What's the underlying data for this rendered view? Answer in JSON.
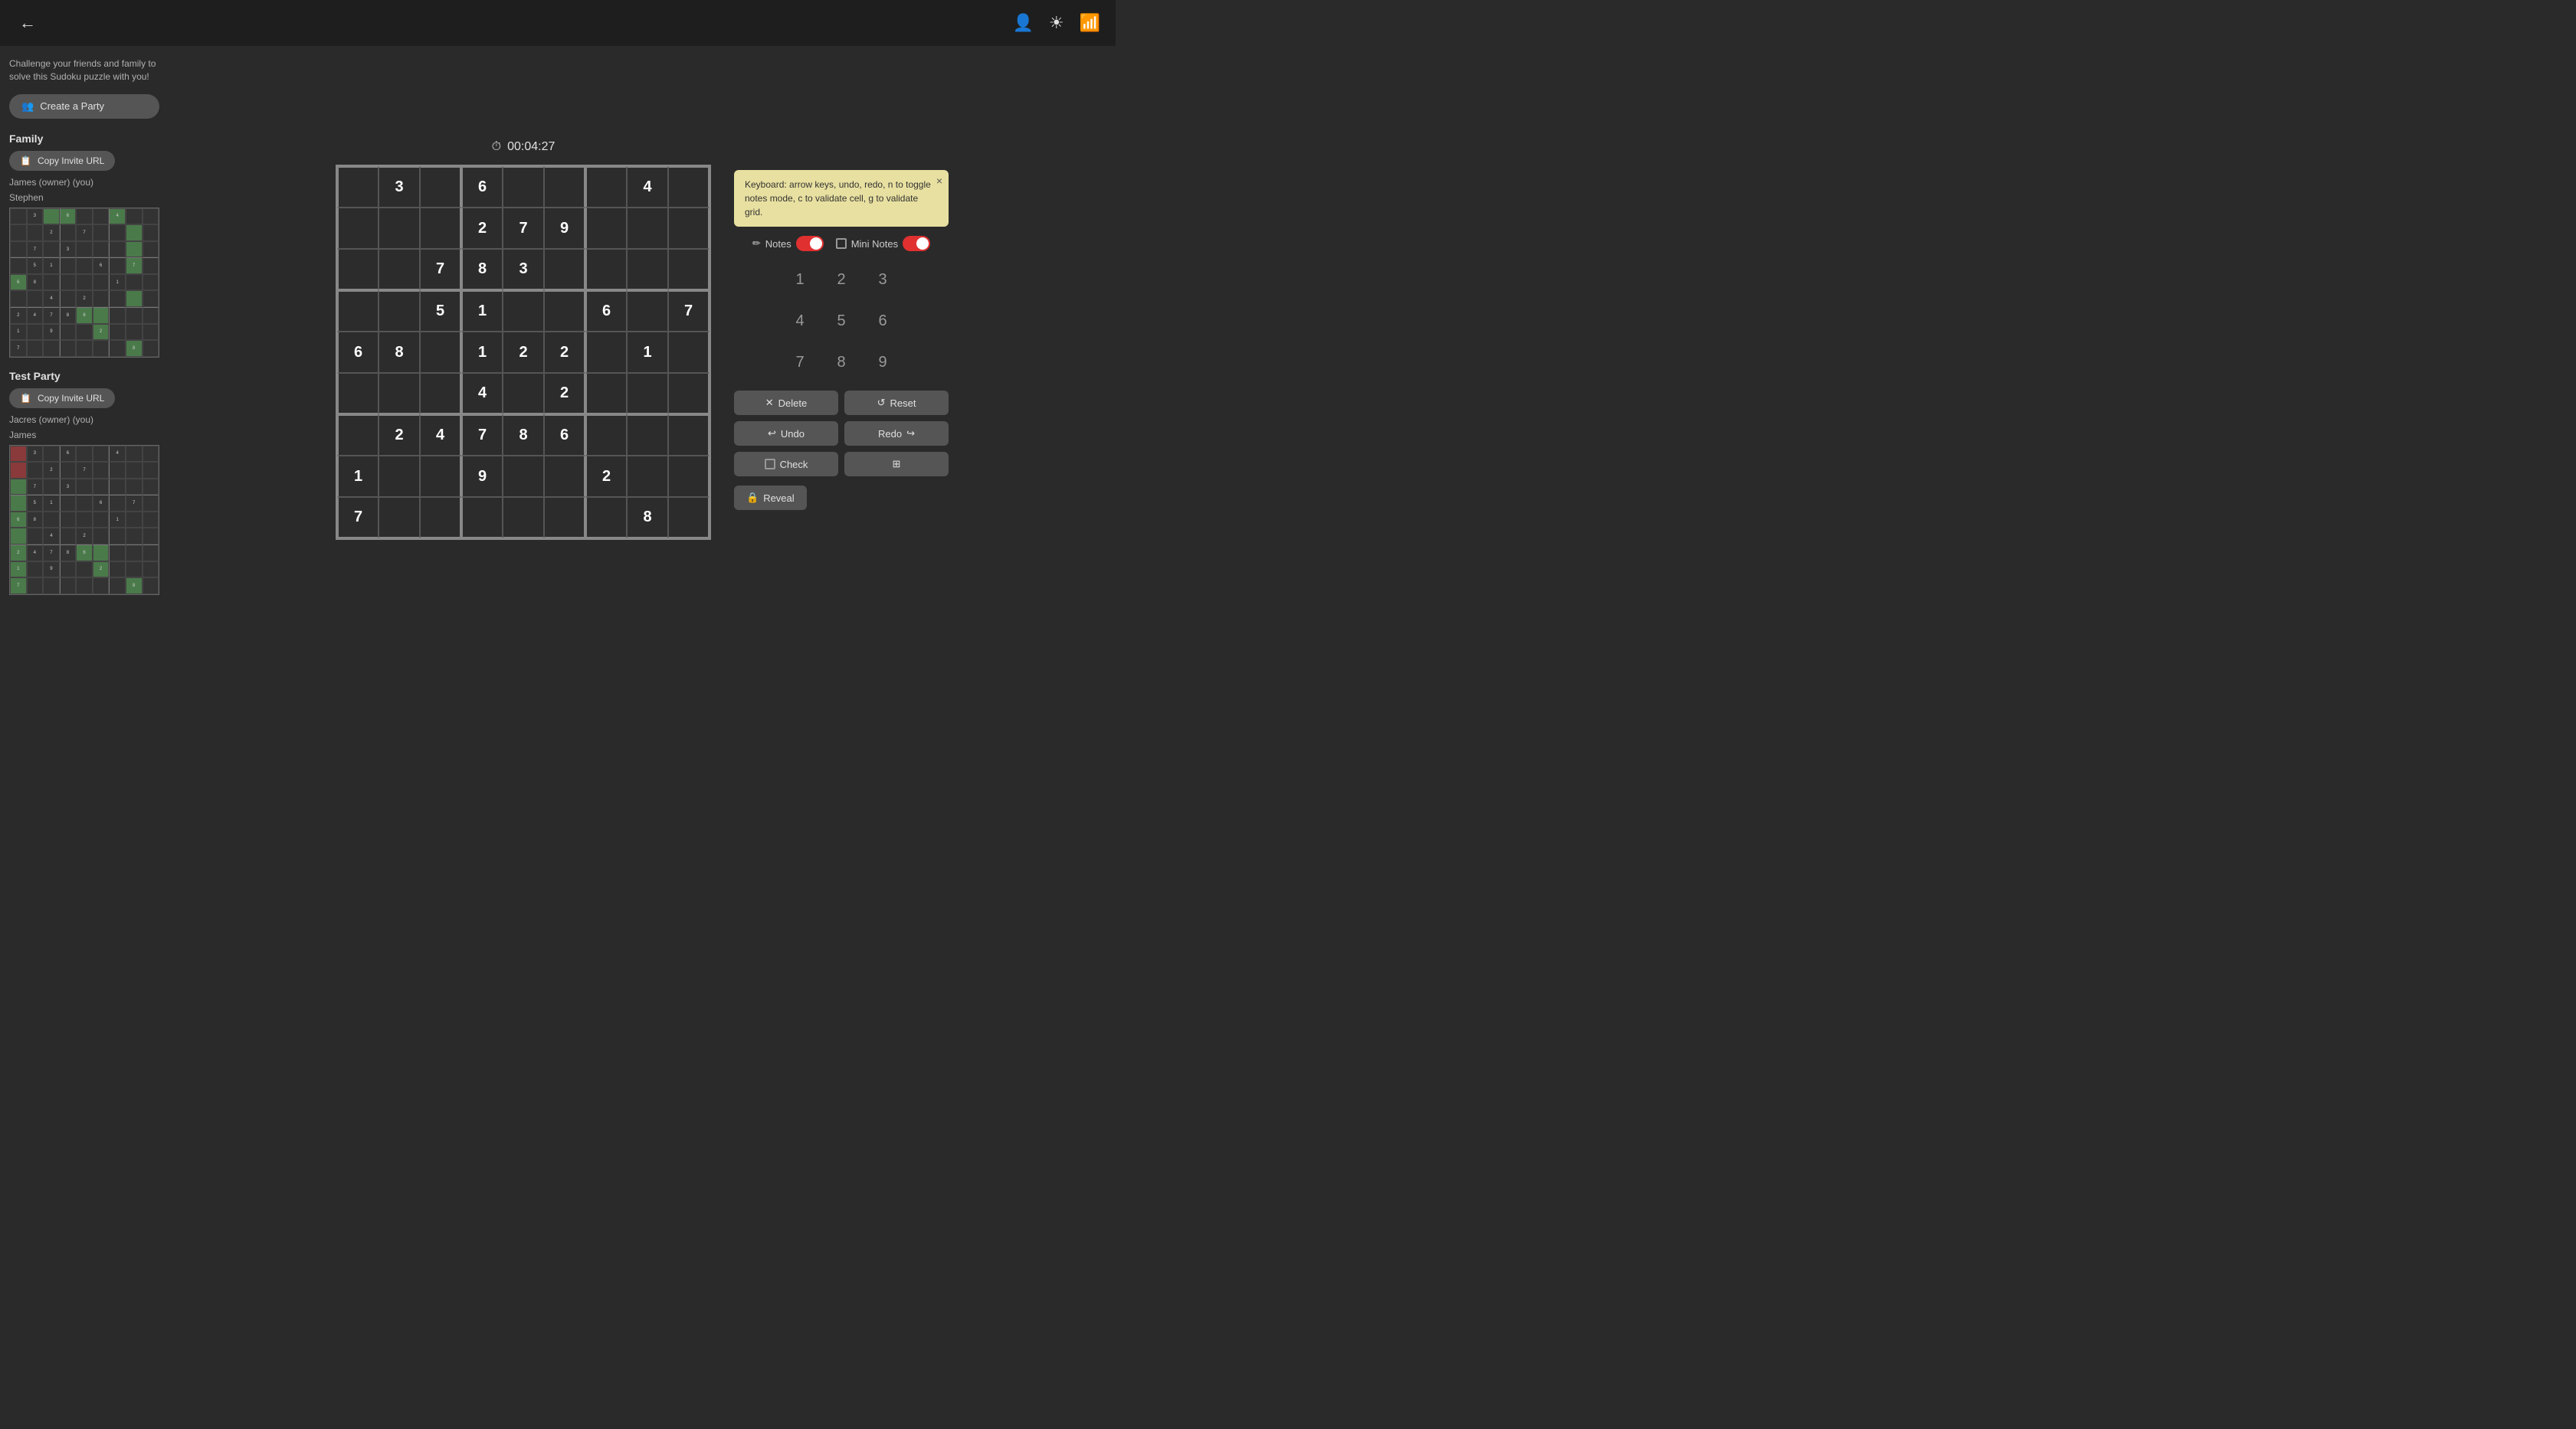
{
  "header": {
    "back_label": "←",
    "icons": [
      "person",
      "brightness",
      "wifi"
    ]
  },
  "sidebar": {
    "description": "Challenge your friends and family to solve this Sudoku puzzle with you!",
    "create_party_label": "Create a Party",
    "parties": [
      {
        "name": "Family",
        "copy_url_label": "Copy Invite URL",
        "members": [
          {
            "name": "James (owner) (you)",
            "grid": null
          },
          {
            "name": "Stephen",
            "grid": [
              [
                "",
                "3",
                "",
                "6",
                "",
                "",
                "4",
                "",
                ""
              ],
              [
                "",
                "",
                "2",
                "",
                "7",
                "",
                "",
                "",
                ""
              ],
              [
                "",
                "7",
                "",
                "3",
                "",
                "",
                "",
                "",
                ""
              ],
              [
                "",
                "5",
                "1",
                "",
                "",
                "6",
                "",
                "7",
                ""
              ],
              [
                "6",
                "8",
                "",
                "",
                "",
                "",
                "1",
                "",
                ""
              ],
              [
                "",
                "",
                "4",
                "",
                "2",
                "",
                "",
                "",
                ""
              ],
              [
                "2",
                "4",
                "7",
                "8",
                "6",
                "",
                "",
                "",
                ""
              ],
              [
                "1",
                "",
                "9",
                "",
                "",
                "2",
                "",
                "",
                ""
              ],
              [
                "7",
                "",
                "",
                "",
                "",
                "",
                "",
                "8",
                ""
              ]
            ],
            "highlights": [
              [
                0,
                2
              ],
              [
                0,
                3
              ],
              [
                0,
                6
              ],
              [
                1,
                7
              ],
              [
                2,
                7
              ],
              [
                3,
                7
              ],
              [
                4,
                0
              ],
              [
                5,
                7
              ],
              [
                6,
                4
              ],
              [
                6,
                5
              ],
              [
                7,
                5
              ],
              [
                8,
                7
              ]
            ]
          }
        ]
      },
      {
        "name": "Test Party",
        "copy_url_label": "Copy Invite URL",
        "members": [
          {
            "name": "Jacres (owner) (you)",
            "grid": null
          },
          {
            "name": "James",
            "grid": [
              [
                "",
                "3",
                "",
                "6",
                "",
                "",
                "4",
                "",
                ""
              ],
              [
                "",
                "",
                "2",
                "",
                "7",
                "",
                "",
                "",
                ""
              ],
              [
                "",
                "7",
                "",
                "3",
                "",
                "",
                "",
                "",
                ""
              ],
              [
                "",
                "5",
                "1",
                "",
                "",
                "6",
                "",
                "7",
                ""
              ],
              [
                "6",
                "8",
                "",
                "",
                "",
                "",
                "1",
                "",
                ""
              ],
              [
                "",
                "",
                "4",
                "",
                "2",
                "",
                "",
                "",
                ""
              ],
              [
                "2",
                "4",
                "7",
                "8",
                "6",
                "",
                "",
                "",
                ""
              ],
              [
                "1",
                "",
                "9",
                "",
                "",
                "2",
                "",
                "",
                ""
              ],
              [
                "7",
                "",
                "",
                "",
                "",
                "",
                "",
                "8",
                ""
              ]
            ],
            "highlights_green": [
              [
                0,
                0
              ],
              [
                1,
                0
              ],
              [
                2,
                0
              ]
            ],
            "highlights_red": [
              [
                0,
                0
              ],
              [
                1,
                0
              ]
            ]
          }
        ]
      }
    ]
  },
  "timer": {
    "display": "00:04:27",
    "icon": "⏱"
  },
  "tooltip": {
    "text": "Keyboard: arrow keys, undo, redo, n to toggle notes mode, c to validate cell, g to validate grid.",
    "close_label": "×"
  },
  "controls": {
    "notes_label": "Notes",
    "mini_notes_label": "Mini Notes",
    "notes_on": true,
    "mini_notes_on": true
  },
  "numpad": {
    "numbers": [
      "1",
      "2",
      "3",
      "4",
      "5",
      "6",
      "7",
      "8",
      "9"
    ]
  },
  "actions": {
    "delete_label": "Delete",
    "reset_label": "Reset",
    "undo_label": "Undo",
    "redo_label": "Redo",
    "check_label": "Check",
    "grid_check_label": "⊞",
    "reveal_label": "Reveal"
  },
  "grid": {
    "cells": [
      [
        "",
        "3",
        "",
        "6",
        "",
        "",
        "",
        "4",
        ""
      ],
      [
        "",
        "",
        "",
        "2",
        "7",
        "9",
        "",
        "",
        ""
      ],
      [
        "",
        "",
        "7",
        "8",
        "3",
        "",
        "",
        "",
        ""
      ],
      [
        "",
        "",
        "5",
        "1",
        "",
        "",
        "6",
        "",
        "7"
      ],
      [
        "6",
        "8",
        "",
        "1",
        "2",
        "2",
        "",
        "1",
        ""
      ],
      [
        "",
        "",
        "",
        "4",
        "",
        "2",
        "",
        "",
        ""
      ],
      [
        "",
        "2",
        "4",
        "7",
        "8",
        "6",
        "",
        "",
        ""
      ],
      [
        "1",
        "",
        "",
        "9",
        "",
        "",
        "2",
        "",
        ""
      ],
      [
        "7",
        "",
        "",
        "",
        "",
        "",
        "",
        "8",
        ""
      ]
    ],
    "given_positions": [
      [
        0,
        1
      ],
      [
        0,
        3
      ],
      [
        0,
        7
      ],
      [
        1,
        3
      ],
      [
        1,
        4
      ],
      [
        1,
        5
      ],
      [
        2,
        2
      ],
      [
        2,
        3
      ],
      [
        2,
        4
      ],
      [
        3,
        2
      ],
      [
        3,
        3
      ],
      [
        3,
        6
      ],
      [
        3,
        8
      ],
      [
        4,
        0
      ],
      [
        4,
        1
      ],
      [
        4,
        3
      ],
      [
        4,
        4
      ],
      [
        4,
        5
      ],
      [
        4,
        7
      ],
      [
        5,
        3
      ],
      [
        5,
        5
      ],
      [
        6,
        1
      ],
      [
        6,
        2
      ],
      [
        6,
        3
      ],
      [
        6,
        4
      ],
      [
        6,
        5
      ],
      [
        7,
        0
      ],
      [
        7,
        3
      ],
      [
        7,
        6
      ],
      [
        8,
        0
      ],
      [
        8,
        7
      ]
    ]
  }
}
